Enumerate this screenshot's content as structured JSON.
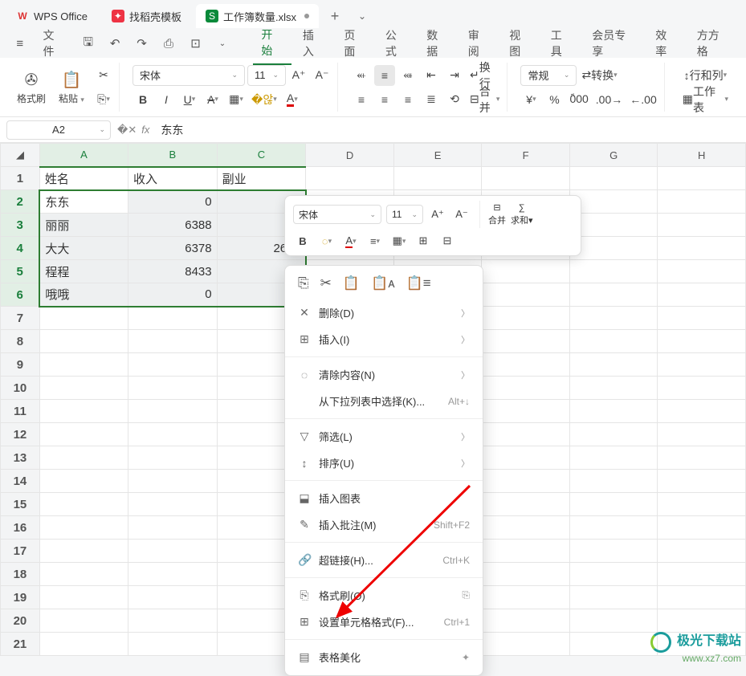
{
  "tabs": {
    "app": "WPS Office",
    "template": "找稻壳模板",
    "file": "工作簿数量.xlsx",
    "add": "+"
  },
  "menubar": {
    "file": "文件",
    "items": [
      "开始",
      "插入",
      "页面",
      "公式",
      "数据",
      "审阅",
      "视图",
      "工具",
      "会员专享",
      "效率",
      "方方格"
    ],
    "active_index": 0
  },
  "ribbon": {
    "format_painter": "格式刷",
    "paste": "粘贴",
    "font_name": "宋体",
    "font_size": "11",
    "wrap": "换行",
    "merge": "合并",
    "numfmt": "常规",
    "transpose": "转换",
    "rowcol": "行和列",
    "worksheet": "工作表"
  },
  "namebox": "A2",
  "formula_value": "东东",
  "columns": [
    "A",
    "B",
    "C",
    "D",
    "E",
    "F",
    "G",
    "H"
  ],
  "row_header": [
    "1",
    "2",
    "3",
    "4",
    "5",
    "6",
    "7",
    "8",
    "9",
    "10",
    "11",
    "12",
    "13",
    "14",
    "15",
    "16",
    "17",
    "18",
    "19",
    "20",
    "21"
  ],
  "cells": {
    "A1": "姓名",
    "B1": "收入",
    "C1": "副业",
    "A2": "东东",
    "B2": "0",
    "A3": "丽丽",
    "B3": "6388",
    "A4": "大大",
    "B4": "6378",
    "C4": "2678",
    "A5": "程程",
    "B5": "8433",
    "A6": "哦哦",
    "B6": "0"
  },
  "minibar": {
    "font_name": "宋体",
    "font_size": "11",
    "merge": "合并",
    "sum": "求和"
  },
  "context_menu": {
    "items": [
      {
        "icon": "✕",
        "label": "删除(D)",
        "arrow": true
      },
      {
        "icon": "⊞",
        "label": "插入(I)",
        "arrow": true
      },
      {
        "sep": true
      },
      {
        "icon": "◌",
        "label": "清除内容(N)",
        "arrow": true
      },
      {
        "icon": "",
        "label": "从下拉列表中选择(K)...",
        "shortcut": "Alt+↓"
      },
      {
        "sep": true
      },
      {
        "icon": "▽",
        "label": "筛选(L)",
        "arrow": true
      },
      {
        "icon": "↕",
        "label": "排序(U)",
        "arrow": true
      },
      {
        "sep": true
      },
      {
        "icon": "⬓",
        "label": "插入图表"
      },
      {
        "icon": "✎",
        "label": "插入批注(M)",
        "shortcut": "Shift+F2"
      },
      {
        "sep": true
      },
      {
        "icon": "🔗",
        "label": "超链接(H)...",
        "shortcut": "Ctrl+K"
      },
      {
        "sep": true
      },
      {
        "icon": "⎘",
        "label": "格式刷(O)",
        "extra": "⎘"
      },
      {
        "icon": "⊞",
        "label": "设置单元格格式(F)...",
        "shortcut": "Ctrl+1"
      },
      {
        "sep": true
      },
      {
        "icon": "▤",
        "label": "表格美化",
        "extra": "✦"
      }
    ]
  },
  "watermark": {
    "title": "极光下载站",
    "url": "www.xz7.com"
  }
}
